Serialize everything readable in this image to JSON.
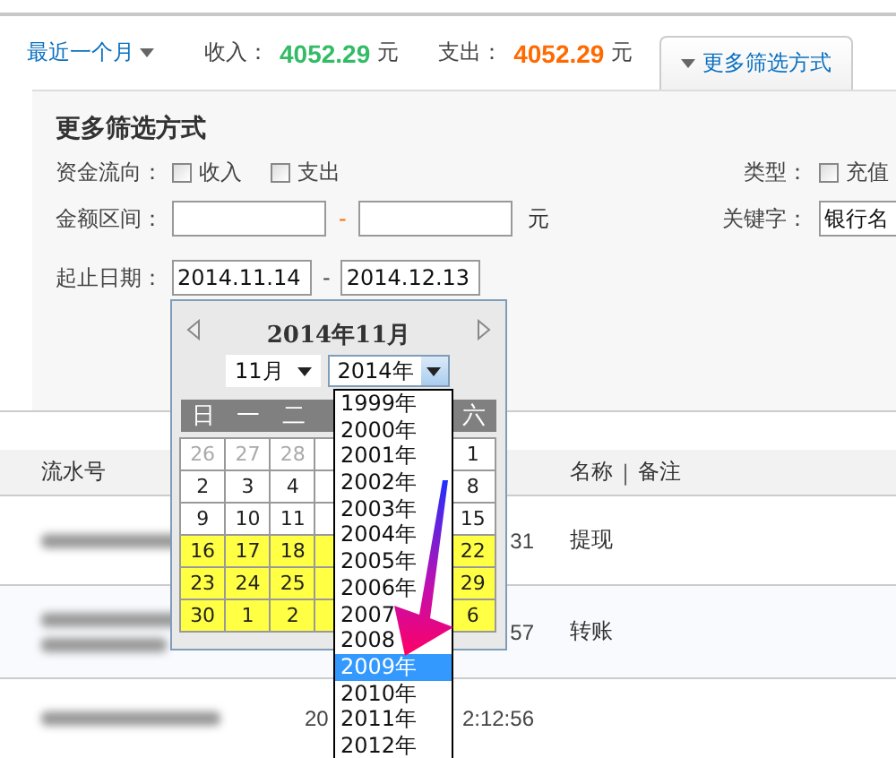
{
  "top_bar": {
    "period": "最近一个月",
    "income_label": "收入：",
    "income": "4052.29",
    "income_unit": "元",
    "expense_label": "支出：",
    "expense": "4052.29",
    "expense_unit": "元",
    "more_tab": {
      "label": "更多筛选方式",
      "selected": true
    }
  },
  "filters": {
    "title": "更多筛选方式",
    "flow_label": "资金流向：",
    "flow_options": [
      {
        "label": "收入",
        "checked": false
      },
      {
        "label": "支出",
        "checked": false
      }
    ],
    "type_label": "类型：",
    "type_options": [
      {
        "label": "充值",
        "checked": false
      }
    ],
    "amount_label": "金额区间：",
    "amount_separator": "-",
    "amount_unit": "元",
    "keyword_label": "关键字：",
    "keyword_value": "银行名",
    "date_label": "起止日期：",
    "date_from": "2014.11.14",
    "date_separator": "-",
    "date_to": "2014.12.13"
  },
  "calendar": {
    "title": "2014年11月",
    "month_select": "11月",
    "year_select": "2014年",
    "weekdays_left": [
      "日",
      "一",
      "二"
    ],
    "weekdays_right": [
      "六"
    ],
    "weeks": [
      {
        "highlighted": false,
        "left": [
          {
            "day": "26",
            "other_month": true
          },
          {
            "day": "27",
            "other_month": true
          },
          {
            "day": "28",
            "other_month": true
          }
        ],
        "right": {
          "day": "1",
          "other_month": false
        }
      },
      {
        "highlighted": false,
        "left": [
          {
            "day": "2",
            "other_month": false
          },
          {
            "day": "3",
            "other_month": false
          },
          {
            "day": "4",
            "other_month": false
          }
        ],
        "right": {
          "day": "8",
          "other_month": false
        }
      },
      {
        "highlighted": false,
        "left": [
          {
            "day": "9",
            "other_month": false
          },
          {
            "day": "10",
            "other_month": false
          },
          {
            "day": "11",
            "other_month": false
          }
        ],
        "right": {
          "day": "15",
          "other_month": false
        }
      },
      {
        "highlighted": true,
        "left": [
          {
            "day": "16",
            "other_month": false
          },
          {
            "day": "17",
            "other_month": false
          },
          {
            "day": "18",
            "other_month": false
          }
        ],
        "right": {
          "day": "22",
          "other_month": false
        }
      },
      {
        "highlighted": true,
        "left": [
          {
            "day": "23",
            "other_month": false
          },
          {
            "day": "24",
            "other_month": false
          },
          {
            "day": "25",
            "other_month": false
          }
        ],
        "right": {
          "day": "29",
          "other_month": false
        }
      },
      {
        "highlighted": true,
        "left": [
          {
            "day": "30",
            "other_month": false
          },
          {
            "day": "1",
            "other_month": false
          },
          {
            "day": "2",
            "other_month": false
          }
        ],
        "right": {
          "day": "6",
          "other_month": false
        }
      }
    ],
    "year_list": [
      {
        "label": "1999年",
        "selected": false
      },
      {
        "label": "2000年",
        "selected": false
      },
      {
        "label": "2001年",
        "selected": false
      },
      {
        "label": "2002年",
        "selected": false
      },
      {
        "label": "2003年",
        "selected": false
      },
      {
        "label": "2004年",
        "selected": false
      },
      {
        "label": "2005年",
        "selected": false
      },
      {
        "label": "2006年",
        "selected": false
      },
      {
        "label": "2007",
        "selected": false
      },
      {
        "label": "2008",
        "selected": false
      },
      {
        "label": "2009年",
        "selected": true
      },
      {
        "label": "2010年",
        "selected": false
      },
      {
        "label": "2011年",
        "selected": false
      },
      {
        "label": "2012年",
        "selected": false
      }
    ]
  },
  "table": {
    "columns": [
      {
        "label": "流水号"
      },
      {
        "label": "名称"
      },
      {
        "label": "备注"
      }
    ],
    "column_separator": "|",
    "rows": [
      {
        "id_two_lines": false,
        "time_end": "31",
        "name": "提现"
      },
      {
        "id_two_lines": true,
        "time_end": "57",
        "name": "转账"
      },
      {
        "id_two_lines": false,
        "time_start": "20",
        "time_end": "2:12:56"
      }
    ]
  }
}
